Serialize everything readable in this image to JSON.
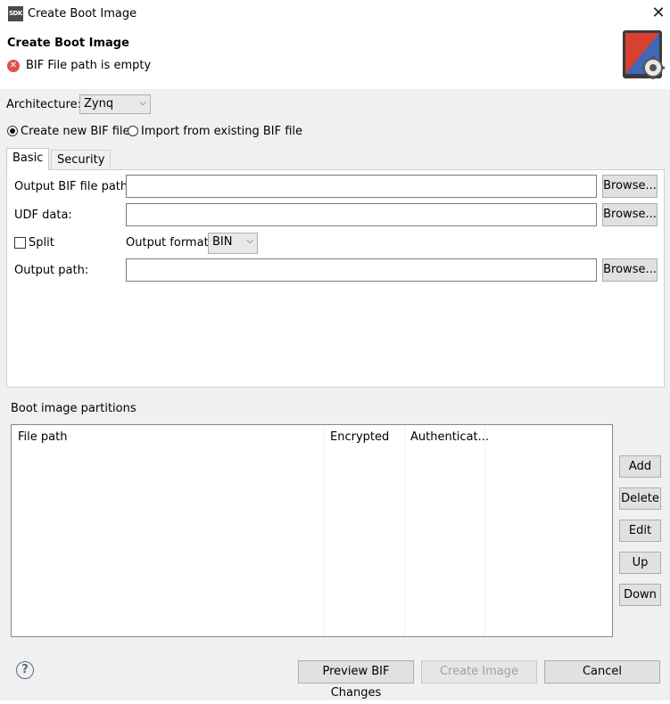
{
  "window": {
    "app_icon_text": "SDK",
    "title": "Create Boot Image"
  },
  "header": {
    "title": "Create Boot Image",
    "error_message": "BIF File path is empty"
  },
  "architecture": {
    "label": "Architecture:",
    "selected": "Zynq"
  },
  "bif_mode": {
    "create_new": "Create new BIF file",
    "import_existing": "Import from existing BIF file"
  },
  "tabs": [
    {
      "label": "Basic"
    },
    {
      "label": "Security"
    }
  ],
  "basic": {
    "output_bif_label": "Output BIF file path:",
    "output_bif_value": "",
    "udf_label": "UDF data:",
    "udf_value": "",
    "split_label": "Split",
    "output_format_label": "Output format:",
    "output_format_value": "BIN",
    "output_path_label": "Output path:",
    "output_path_value": "",
    "browse_label": "Browse..."
  },
  "partitions": {
    "section_label": "Boot image partitions",
    "columns": [
      "File path",
      "Encrypted",
      "Authenticat..."
    ]
  },
  "side_buttons": {
    "add": "Add",
    "delete": "Delete",
    "edit": "Edit",
    "up": "Up",
    "down": "Down"
  },
  "footer": {
    "help": "?",
    "preview": "Preview BIF Changes",
    "create": "Create Image",
    "cancel": "Cancel"
  }
}
